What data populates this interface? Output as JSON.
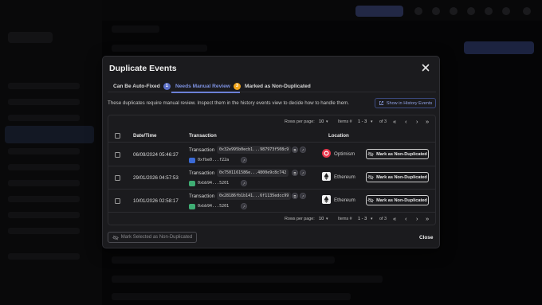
{
  "dialog": {
    "title": "Duplicate Events",
    "tabs": [
      {
        "label": "Can Be Auto-Fixed",
        "badge": "1",
        "badge_color": "#5b6fc7"
      },
      {
        "label": "Needs Manual Review",
        "badge": "3",
        "badge_color": "#f2a51a"
      },
      {
        "label": "Marked as Non-Duplicated",
        "badge": "",
        "badge_color": ""
      }
    ],
    "active_tab": 1,
    "description": "These duplicates require manual review. Inspect them in the history events view to decide how to handle them.",
    "show_history_button": "Show in History Events",
    "table": {
      "pager": {
        "rows_per_page_label": "Rows per page:",
        "rows_per_page_value": "10",
        "items_label": "Items #",
        "items_range": "1 - 3",
        "items_total": "of 3"
      },
      "headers": {
        "date": "Date/Time",
        "transaction": "Transaction",
        "location": "Location"
      },
      "rows": [
        {
          "date": "06/09/2024 05:46:37",
          "tx_label": "Transaction",
          "hash": "0x32e995b0ecb1...987973f508c9",
          "address": "0xfbe0...f22a",
          "address_color": "#3b6ad6",
          "chain": "Optimism",
          "chain_color": "#e8344a",
          "action": "Mark as Non-Duplicated"
        },
        {
          "date": "29/01/2026 04:57:53",
          "tx_label": "Transaction",
          "hash": "0x7501161586e...4800e9c8c742",
          "address": "0xbb94...5201",
          "address_color": "#3fae74",
          "chain": "Ethereum",
          "chain_color": "#f2f2f2",
          "action": "Mark as Non-Duplicated"
        },
        {
          "date": "10/01/2026 02:58:17",
          "tx_label": "Transaction",
          "hash": "0x28186fb1b141...6f1135edcc99",
          "address": "0xbb94...5201",
          "address_color": "#3fae74",
          "chain": "Ethereum",
          "chain_color": "#f2f2f2",
          "action": "Mark as Non-Duplicated"
        }
      ]
    },
    "footer": {
      "mark_selected": "Mark Selected as Non-Duplicated",
      "close": "Close"
    }
  },
  "icons": {
    "close": "close-icon",
    "external_link": "external-link-icon",
    "eye_off": "eye-off-icon",
    "copy": "copy-icon",
    "link": "link-icon",
    "first_page": "first-page-icon",
    "prev_page": "prev-page-icon",
    "next_page": "next-page-icon",
    "last_page": "last-page-icon"
  }
}
